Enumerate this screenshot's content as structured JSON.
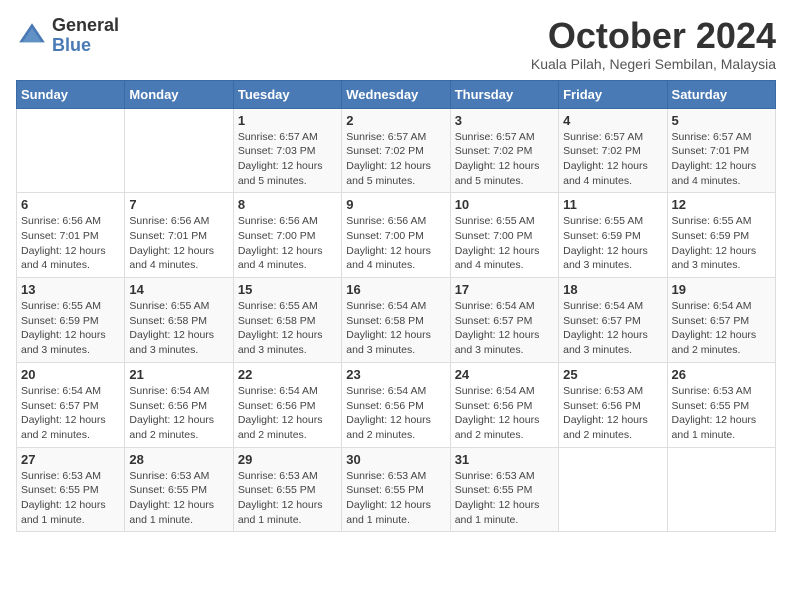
{
  "logo": {
    "line1": "General",
    "line2": "Blue"
  },
  "title": "October 2024",
  "location": "Kuala Pilah, Negeri Sembilan, Malaysia",
  "headers": [
    "Sunday",
    "Monday",
    "Tuesday",
    "Wednesday",
    "Thursday",
    "Friday",
    "Saturday"
  ],
  "weeks": [
    [
      {
        "day": "",
        "info": ""
      },
      {
        "day": "",
        "info": ""
      },
      {
        "day": "1",
        "info": "Sunrise: 6:57 AM\nSunset: 7:03 PM\nDaylight: 12 hours\nand 5 minutes."
      },
      {
        "day": "2",
        "info": "Sunrise: 6:57 AM\nSunset: 7:02 PM\nDaylight: 12 hours\nand 5 minutes."
      },
      {
        "day": "3",
        "info": "Sunrise: 6:57 AM\nSunset: 7:02 PM\nDaylight: 12 hours\nand 5 minutes."
      },
      {
        "day": "4",
        "info": "Sunrise: 6:57 AM\nSunset: 7:02 PM\nDaylight: 12 hours\nand 4 minutes."
      },
      {
        "day": "5",
        "info": "Sunrise: 6:57 AM\nSunset: 7:01 PM\nDaylight: 12 hours\nand 4 minutes."
      }
    ],
    [
      {
        "day": "6",
        "info": "Sunrise: 6:56 AM\nSunset: 7:01 PM\nDaylight: 12 hours\nand 4 minutes."
      },
      {
        "day": "7",
        "info": "Sunrise: 6:56 AM\nSunset: 7:01 PM\nDaylight: 12 hours\nand 4 minutes."
      },
      {
        "day": "8",
        "info": "Sunrise: 6:56 AM\nSunset: 7:00 PM\nDaylight: 12 hours\nand 4 minutes."
      },
      {
        "day": "9",
        "info": "Sunrise: 6:56 AM\nSunset: 7:00 PM\nDaylight: 12 hours\nand 4 minutes."
      },
      {
        "day": "10",
        "info": "Sunrise: 6:55 AM\nSunset: 7:00 PM\nDaylight: 12 hours\nand 4 minutes."
      },
      {
        "day": "11",
        "info": "Sunrise: 6:55 AM\nSunset: 6:59 PM\nDaylight: 12 hours\nand 3 minutes."
      },
      {
        "day": "12",
        "info": "Sunrise: 6:55 AM\nSunset: 6:59 PM\nDaylight: 12 hours\nand 3 minutes."
      }
    ],
    [
      {
        "day": "13",
        "info": "Sunrise: 6:55 AM\nSunset: 6:59 PM\nDaylight: 12 hours\nand 3 minutes."
      },
      {
        "day": "14",
        "info": "Sunrise: 6:55 AM\nSunset: 6:58 PM\nDaylight: 12 hours\nand 3 minutes."
      },
      {
        "day": "15",
        "info": "Sunrise: 6:55 AM\nSunset: 6:58 PM\nDaylight: 12 hours\nand 3 minutes."
      },
      {
        "day": "16",
        "info": "Sunrise: 6:54 AM\nSunset: 6:58 PM\nDaylight: 12 hours\nand 3 minutes."
      },
      {
        "day": "17",
        "info": "Sunrise: 6:54 AM\nSunset: 6:57 PM\nDaylight: 12 hours\nand 3 minutes."
      },
      {
        "day": "18",
        "info": "Sunrise: 6:54 AM\nSunset: 6:57 PM\nDaylight: 12 hours\nand 3 minutes."
      },
      {
        "day": "19",
        "info": "Sunrise: 6:54 AM\nSunset: 6:57 PM\nDaylight: 12 hours\nand 2 minutes."
      }
    ],
    [
      {
        "day": "20",
        "info": "Sunrise: 6:54 AM\nSunset: 6:57 PM\nDaylight: 12 hours\nand 2 minutes."
      },
      {
        "day": "21",
        "info": "Sunrise: 6:54 AM\nSunset: 6:56 PM\nDaylight: 12 hours\nand 2 minutes."
      },
      {
        "day": "22",
        "info": "Sunrise: 6:54 AM\nSunset: 6:56 PM\nDaylight: 12 hours\nand 2 minutes."
      },
      {
        "day": "23",
        "info": "Sunrise: 6:54 AM\nSunset: 6:56 PM\nDaylight: 12 hours\nand 2 minutes."
      },
      {
        "day": "24",
        "info": "Sunrise: 6:54 AM\nSunset: 6:56 PM\nDaylight: 12 hours\nand 2 minutes."
      },
      {
        "day": "25",
        "info": "Sunrise: 6:53 AM\nSunset: 6:56 PM\nDaylight: 12 hours\nand 2 minutes."
      },
      {
        "day": "26",
        "info": "Sunrise: 6:53 AM\nSunset: 6:55 PM\nDaylight: 12 hours\nand 1 minute."
      }
    ],
    [
      {
        "day": "27",
        "info": "Sunrise: 6:53 AM\nSunset: 6:55 PM\nDaylight: 12 hours\nand 1 minute."
      },
      {
        "day": "28",
        "info": "Sunrise: 6:53 AM\nSunset: 6:55 PM\nDaylight: 12 hours\nand 1 minute."
      },
      {
        "day": "29",
        "info": "Sunrise: 6:53 AM\nSunset: 6:55 PM\nDaylight: 12 hours\nand 1 minute."
      },
      {
        "day": "30",
        "info": "Sunrise: 6:53 AM\nSunset: 6:55 PM\nDaylight: 12 hours\nand 1 minute."
      },
      {
        "day": "31",
        "info": "Sunrise: 6:53 AM\nSunset: 6:55 PM\nDaylight: 12 hours\nand 1 minute."
      },
      {
        "day": "",
        "info": ""
      },
      {
        "day": "",
        "info": ""
      }
    ]
  ]
}
